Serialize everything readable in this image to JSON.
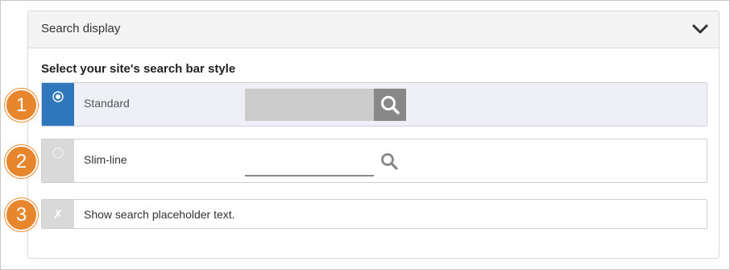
{
  "panel": {
    "title": "Search display",
    "collapse_icon": "chevron-down-icon"
  },
  "section": {
    "label": "Select your site's search bar style"
  },
  "options": [
    {
      "number": "1",
      "label": "Standard",
      "selected": true,
      "icon": "search-icon"
    },
    {
      "number": "2",
      "label": "Slim-line",
      "selected": false,
      "icon": "search-icon"
    }
  ],
  "placeholder_toggle": {
    "number": "3",
    "label": "Show search placeholder text.",
    "enabled": false,
    "mark": "✗"
  },
  "colors": {
    "accent": "#2f77bc",
    "badge": "#e8862e",
    "gutter_inactive": "#d9d9d9",
    "selected_row_bg": "#eff0f6",
    "preview_bar": "#cccccc",
    "preview_button": "#888888"
  }
}
